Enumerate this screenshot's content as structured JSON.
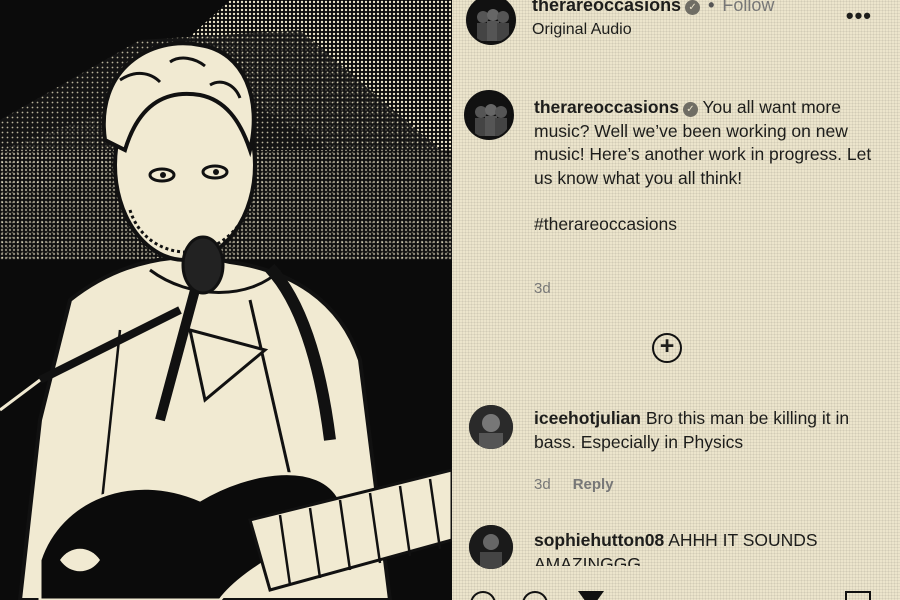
{
  "header": {
    "username": "therareoccasions",
    "follow_label": "Follow",
    "audio_label": "Original Audio",
    "more_icon": "more-horizontal-icon"
  },
  "caption": {
    "username": "therareoccasions",
    "text": "You all want more music? Well we’ve been working on new music! Here’s another work in progress. Let us know what you all think!",
    "hashtag": "#therareoccasions",
    "time": "3d"
  },
  "load_more_icon": "plus-circle-icon",
  "comments": [
    {
      "username": "iceehotjulian",
      "text": "Bro this man be killing it in bass. Especially in Physics",
      "time": "3d",
      "reply_label": "Reply"
    },
    {
      "username": "sophiehutton08",
      "text": "AHHH IT SOUNDS AMAZINGGG"
    }
  ],
  "actions": [
    "heart-icon",
    "comment-icon",
    "share-icon",
    "bookmark-icon"
  ],
  "colors": {
    "paper": "#f1ead2",
    "ink": "#1d1d1b",
    "muted": "#777777"
  }
}
